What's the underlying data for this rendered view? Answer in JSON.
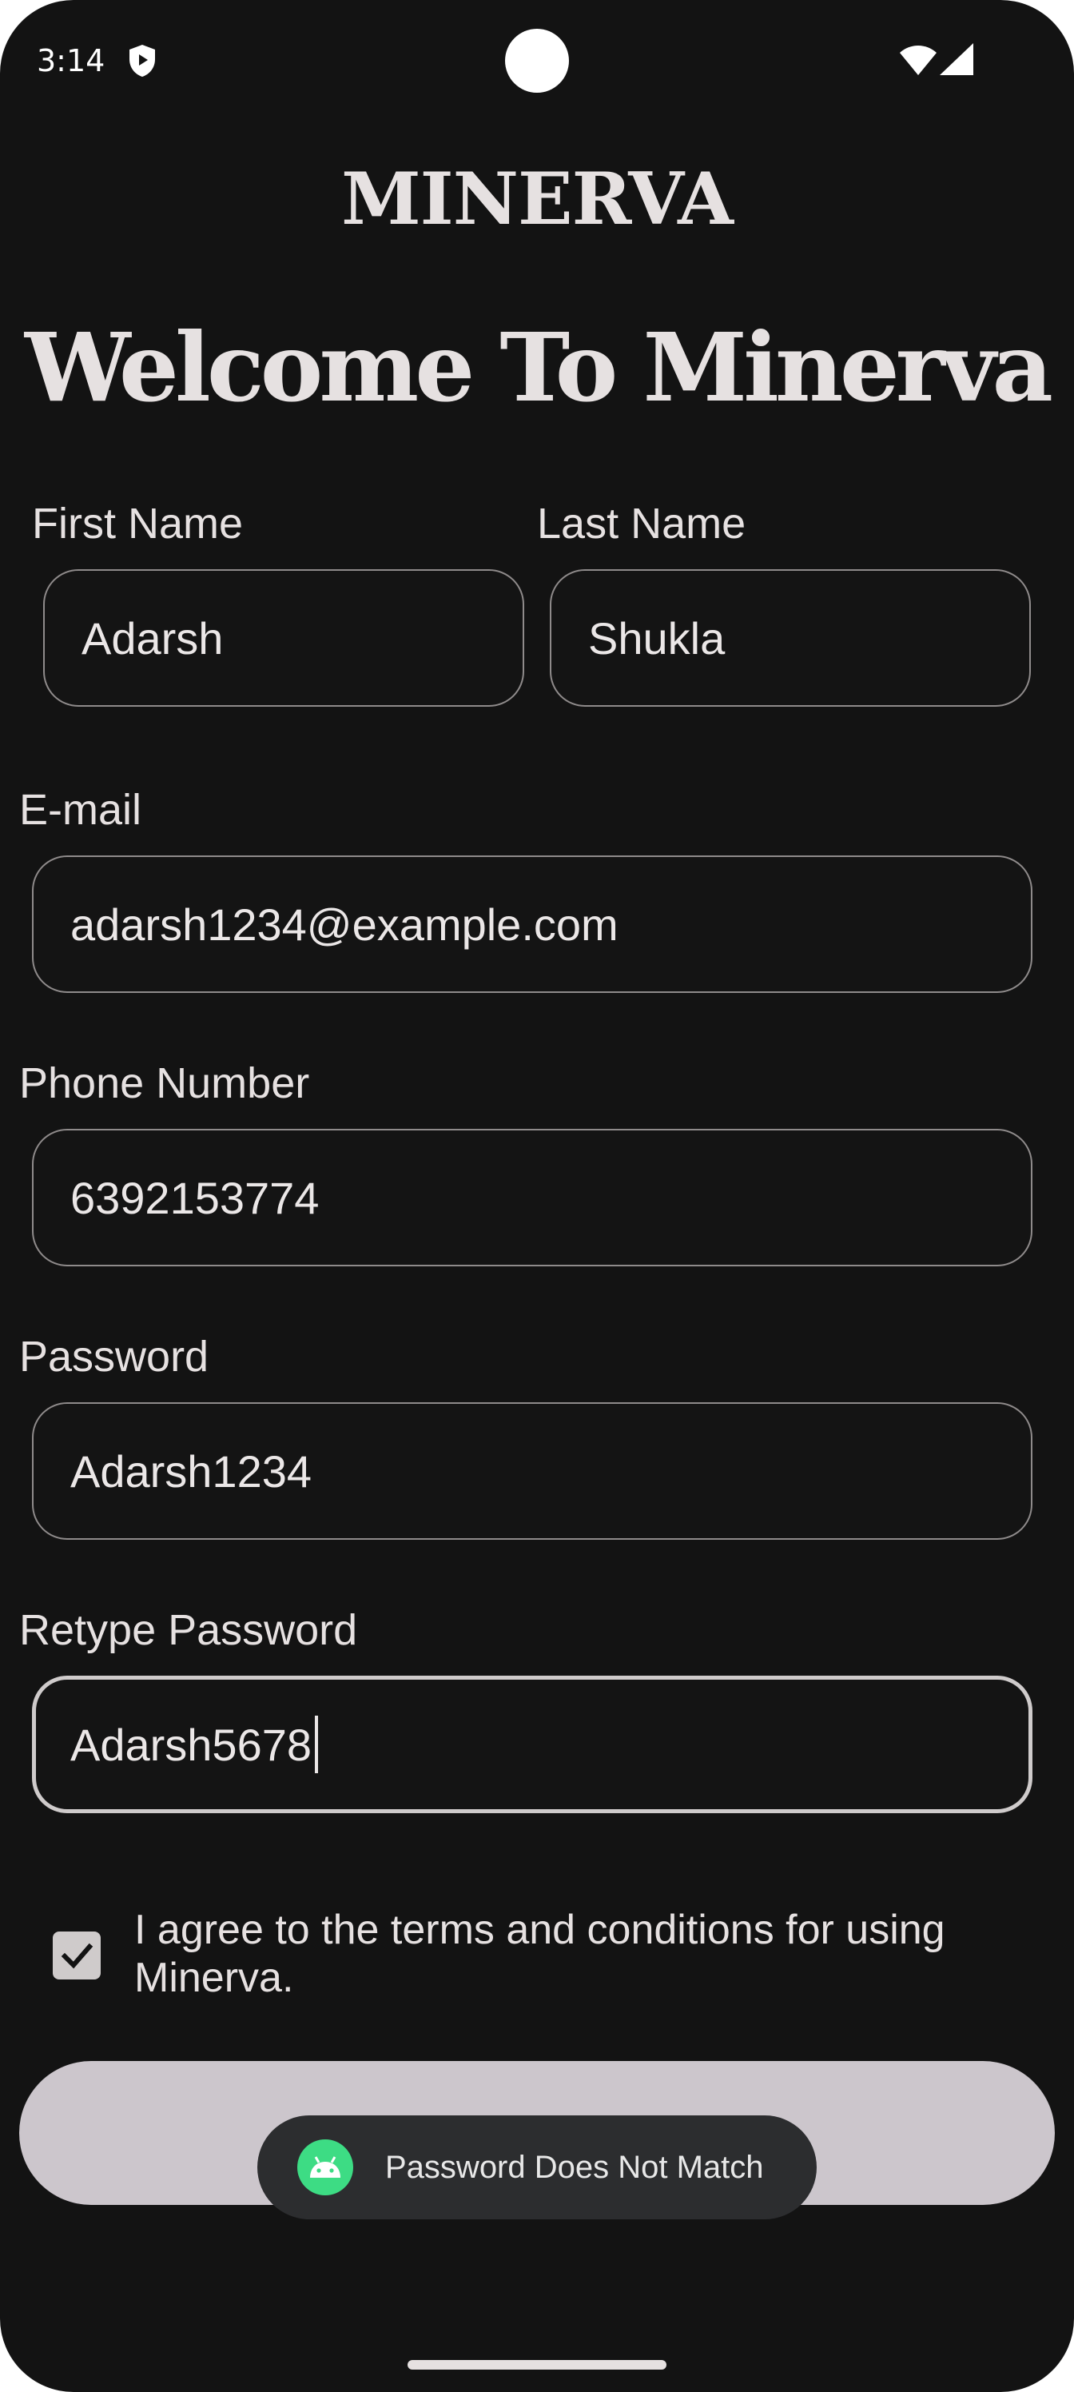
{
  "status_bar": {
    "time": "3:14"
  },
  "header": {
    "brand": "MINERVA",
    "welcome": "Welcome To Minerva"
  },
  "form": {
    "first_name": {
      "label": "First Name",
      "value": "Adarsh"
    },
    "last_name": {
      "label": "Last Name",
      "value": "Shukla"
    },
    "email": {
      "label": "E-mail",
      "value": "adarsh1234@example.com"
    },
    "phone": {
      "label": "Phone Number",
      "value": "6392153774"
    },
    "password": {
      "label": "Password",
      "value": "Adarsh1234"
    },
    "retype_password": {
      "label": "Retype Password",
      "value": "Adarsh5678"
    },
    "terms": {
      "checked": true,
      "text": "I agree to the terms and conditions for using Minerva."
    },
    "submit": {
      "label": ""
    }
  },
  "toast": {
    "icon": "android-icon",
    "message": "Password Does Not Match"
  },
  "colors": {
    "background": "#131313",
    "text": "#e6e1e1",
    "button": "#ccc6cc",
    "toast": "#2c2d2f",
    "android_green": "#3ddc84"
  }
}
